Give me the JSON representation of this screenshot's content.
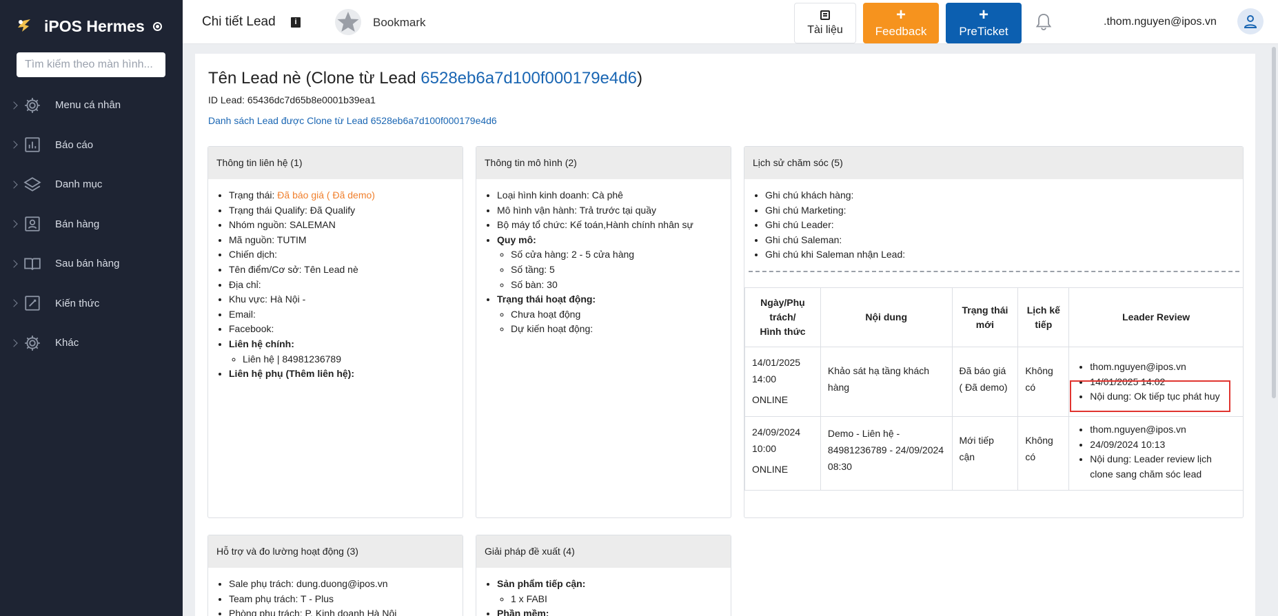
{
  "brand": {
    "name": "iPOS Hermes"
  },
  "sidebar": {
    "search_placeholder": "Tìm kiếm theo màn hình...",
    "items": [
      {
        "label": "Menu cá nhân",
        "icon": "gear-icon"
      },
      {
        "label": "Báo cáo",
        "icon": "chart-icon"
      },
      {
        "label": "Danh mục",
        "icon": "layers-icon"
      },
      {
        "label": "Bán hàng",
        "icon": "contact-icon"
      },
      {
        "label": "Sau bán hàng",
        "icon": "book-icon"
      },
      {
        "label": "Kiến thức",
        "icon": "edit-icon"
      },
      {
        "label": "Khác",
        "icon": "gear-icon"
      }
    ]
  },
  "header": {
    "title": "Chi tiết Lead",
    "bookmark": "Bookmark",
    "docs": "Tài liệu",
    "feedback": "Feedback",
    "preticket": "PreTicket",
    "plus": "+",
    "user_email": ".thom.nguyen@ipos.vn"
  },
  "lead": {
    "title_prefix": "Tên Lead nè (Clone từ Lead ",
    "clone_id": "6528eb6a7d100f000179e4d6",
    "title_suffix": ")",
    "id_line": "ID Lead: 65436dc7d65b8e0001b39ea1",
    "clone_list_link": "Danh sách Lead được Clone từ Lead 6528eb6a7d100f000179e4d6"
  },
  "contact": {
    "header": "Thông tin liên hệ (1)",
    "status_label": "Trạng thái: ",
    "status_value": "Đã báo giá ( Đã demo)",
    "qualify": "Trạng thái Qualify: Đã Qualify",
    "source_group": "Nhóm nguồn: SALEMAN",
    "source_code": "Mã nguồn: TUTIM",
    "campaign": "Chiến dịch:",
    "place": "Tên điểm/Cơ sở: Tên Lead nè",
    "address": "Địa chỉ:",
    "area": "Khu vực: Hà Nội -",
    "email": "Email:",
    "facebook": "Facebook:",
    "main_contact": "Liên hệ chính:",
    "main_contact_item": "Liên hệ | 84981236789",
    "sub_contact": "Liên hệ phụ (Thêm liên hệ):"
  },
  "model": {
    "header": "Thông tin mô hình (2)",
    "business_type": "Loại hình kinh doanh: Cà phê",
    "operation": "Mô hình vận hành: Trả trước tại quầy",
    "org": "Bộ máy tổ chức: Kế toán,Hành chính nhân sự",
    "scale": "Quy mô:",
    "stores": "Số cửa hàng: 2 - 5 cửa hàng",
    "floors": "Số tầng: 5",
    "tables": "Số bàn: 30",
    "op_status": "Trạng thái hoạt động:",
    "not_active": "Chưa hoạt động",
    "planned": "Dự kiến hoạt động:"
  },
  "history": {
    "header": "Lịch sử chăm sóc (5)",
    "notes": [
      "Ghi chú khách hàng:",
      "Ghi chú Marketing:",
      "Ghi chú Leader:",
      "Ghi chú Saleman:",
      "Ghi chú khi Saleman nhận Lead:"
    ],
    "columns": {
      "c1_l1": "Ngày/Phụ",
      "c1_l2": "trách/",
      "c1_l3": "Hình thức",
      "c2": "Nội dung",
      "c3_l1": "Trạng thái",
      "c3_l2": "mới",
      "c4_l1": "Lịch kế",
      "c4_l2": "tiếp",
      "c5": "Leader Review"
    },
    "rows": [
      {
        "date": "14/01/2025",
        "time": "14:00",
        "method": "ONLINE",
        "content": "Khảo sát hạ tầng khách hàng",
        "status": "Đã báo giá ( Đã demo)",
        "next": "Không có",
        "review": [
          "thom.nguyen@ipos.vn",
          "14/01/2025 14:02",
          "Nội dung: Ok tiếp tục phát huy"
        ]
      },
      {
        "date": "24/09/2024",
        "time": "10:00",
        "method": "ONLINE",
        "content": "Demo - Liên hệ - 84981236789 - 24/09/2024 08:30",
        "status": "Mới tiếp cận",
        "next": "Không có",
        "review": [
          "thom.nguyen@ipos.vn",
          "24/09/2024 10:13",
          "Nội dung: Leader review lịch clone sang chăm sóc lead"
        ]
      }
    ]
  },
  "support": {
    "header": "Hỗ trợ và đo lường hoạt động (3)",
    "sale": "Sale phụ trách: dung.duong@ipos.vn",
    "team": "Team phụ trách: T - Plus",
    "dept": "Phòng phụ trách: P. Kinh doanh Hà Nội"
  },
  "solution": {
    "header": "Giải pháp đề xuất (4)",
    "products_label": "Sản phẩm tiếp cận:",
    "product_item": "1 x FABI",
    "software_label": "Phần mềm:"
  }
}
